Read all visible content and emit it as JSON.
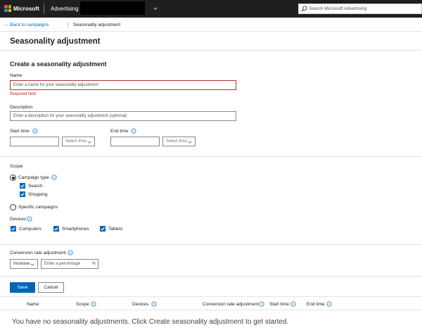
{
  "header": {
    "brand": "Microsoft",
    "product": "Advertising",
    "search_placeholder": "Search Microsoft Advertising"
  },
  "breadcrumb": {
    "back": "← Back to campaigns",
    "current": "Seasonality adjustment"
  },
  "page_title": "Seasonality adjustment",
  "form": {
    "section_title": "Create a seasonality adjustment",
    "name_label": "Name",
    "name_placeholder": "Enter a name for your seasonality adjustment",
    "name_error": "Required field",
    "description_label": "Description",
    "description_placeholder": "Enter a description for your seasonality adjustment (optional)",
    "start_time_label": "Start time",
    "end_time_label": "End time",
    "select_time": "Select time",
    "scope_label": "Scope",
    "campaign_type_label": "Campaign type",
    "campaign_types": [
      "Search",
      "Shopping"
    ],
    "specific_campaigns_label": "Specific campaigns",
    "devices_label": "Devices",
    "devices": [
      "Computers",
      "Smartphones",
      "Tablets"
    ],
    "cra_label": "Conversion rate adjustment",
    "cra_direction": "Increase",
    "cra_placeholder": "Enter a percentage",
    "percent_symbol": "%",
    "save_label": "Save",
    "cancel_label": "Cancel"
  },
  "table": {
    "columns": [
      "Name",
      "Scope",
      "Devices",
      "Conversion rate adjustment",
      "Start time",
      "End time"
    ],
    "empty_message": "You have no seasonality adjustments. Click Create seasonality adjustment to get started."
  },
  "colors": {
    "accent": "#0067b8",
    "error": "#b03030",
    "topbar": "#1f1f1f"
  }
}
